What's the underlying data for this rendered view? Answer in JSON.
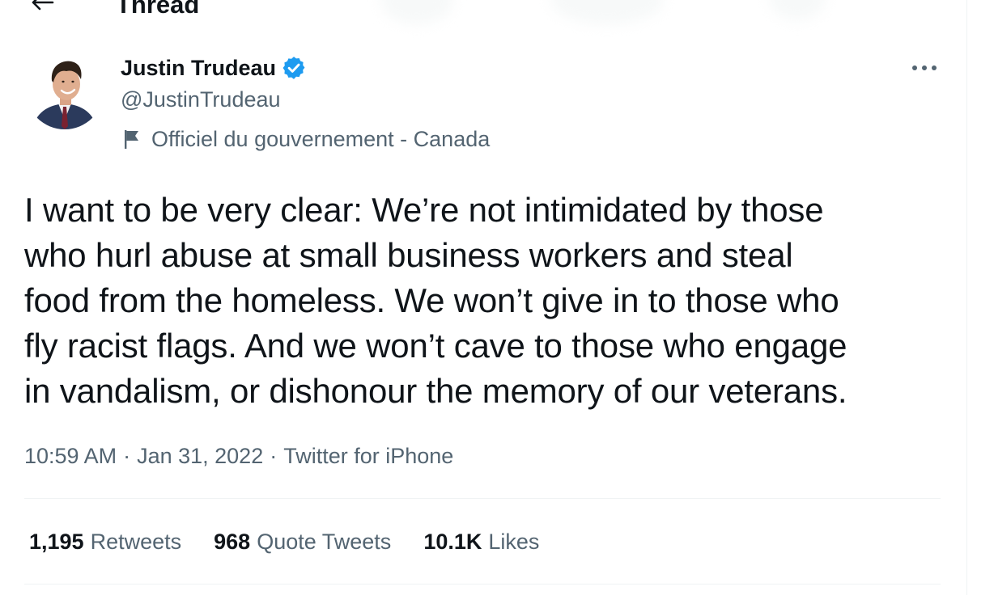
{
  "header": {
    "title": "Thread",
    "back_icon": "back-arrow-icon"
  },
  "author": {
    "name": "Justin Trudeau",
    "handle": "@JustinTrudeau",
    "verified_icon": "verified-badge-icon",
    "label_icon": "flag-icon",
    "label": "Officiel du gouvernement - Canada",
    "more_icon": "more-icon"
  },
  "tweet": {
    "text": "I want to be very clear: We’re not intimidated by those\nwho hurl abuse at small business workers and steal\nfood from the homeless. We won’t give in to those who\nfly racist flags. And we won’t cave to those who engage\nin vandalism, or dishonour the memory of our veterans.",
    "time": "10:59 AM",
    "date": "Jan 31, 2022",
    "source": "Twitter for iPhone",
    "separator": "·"
  },
  "stats": {
    "retweets_count": "1,195",
    "retweets_label": "Retweets",
    "quotes_count": "968",
    "quotes_label": "Quote Tweets",
    "likes_count": "10.1K",
    "likes_label": "Likes"
  },
  "colors": {
    "text_primary": "#0f1419",
    "text_secondary": "#536471",
    "verified_blue": "#1d9bf0",
    "divider": "#eff3f4"
  }
}
